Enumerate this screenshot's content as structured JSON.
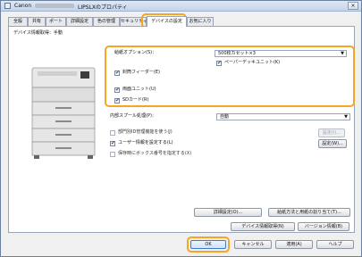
{
  "window": {
    "title_prefix": "Canon",
    "title_suffix": "LIPSLXのプロパティ",
    "close_label": "×"
  },
  "tabs": [
    {
      "label": "全般"
    },
    {
      "label": "共有"
    },
    {
      "label": "ポート"
    },
    {
      "label": "詳細設定"
    },
    {
      "label": "色の管理"
    },
    {
      "label": "セキュリティ"
    },
    {
      "label": "デバイスの設定"
    },
    {
      "label": "お気に入り"
    }
  ],
  "panel": {
    "device_info_label": "デバイス情報取得：手動",
    "paper_option_label": "給紙オプション(S)：",
    "paper_option_value": "500枚カセット×3",
    "paper_deck_label": "ペーパーデッキユニット(K)",
    "envelope_feeder_label": "封筒フィーダー(E)",
    "duplex_unit_label": "両面ユニット(U)",
    "sd_card_label": "SDカード(R)",
    "spool_label": "内部スプール処理(P)：",
    "spool_value": "自動",
    "dept_id_label": "部門別ID管理機能を使う(J)",
    "dept_settings_button": "設定(I)...",
    "user_info_label": "ユーザー情報を設定する(L)",
    "user_settings_button": "設定(W)...",
    "confidential_label": "保存時にボックス番号を指定する(X)",
    "detail_settings_button": "詳細設定(O)...",
    "paper_assign_button": "給紙方法と用紙の割り当て(T)...",
    "get_device_info_button": "デバイス情報取得(N)",
    "version_info_button": "バージョン情報(B)"
  },
  "footer": {
    "ok_button": "OK",
    "cancel_button": "キャンセル",
    "apply_button": "適用(A)",
    "help_button": "ヘルプ"
  },
  "state": {
    "paper_deck_checked": true,
    "envelope_feeder_checked": true,
    "duplex_unit_checked": true,
    "sd_card_checked": true,
    "dept_id_checked": false,
    "user_info_checked": true,
    "confidential_checked": false
  },
  "colors": {
    "highlight": "#f5a623",
    "accent": "#3e7bc4"
  }
}
